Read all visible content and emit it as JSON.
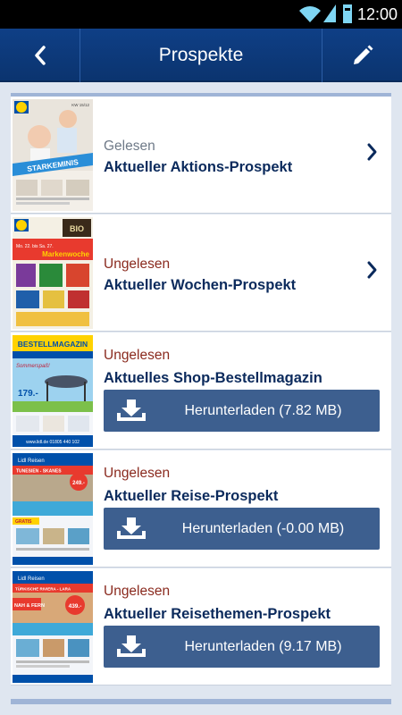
{
  "statusbar": {
    "time": "12:00"
  },
  "actionbar": {
    "title": "Prospekte"
  },
  "brochures": [
    {
      "status": "Gelesen",
      "title": "Aktueller Aktions-Prospekt",
      "action": "chevron",
      "thumb": {
        "header": "LIDL",
        "code": "KW 15/12",
        "banner": "STARKEMINIS"
      }
    },
    {
      "status": "Ungelesen",
      "title": "Aktueller Wochen-Prospekt",
      "action": "chevron",
      "thumb": {
        "header": "LIDL",
        "date": "Mo. 22. bis Sa. 27.",
        "banner": "Markenwoche",
        "badge": "BIO"
      }
    },
    {
      "status": "Ungelesen",
      "title": "Aktuelles Shop-Bestellmagazin",
      "action": "download",
      "download_label": "Herunterladen (7.82 MB)",
      "thumb": {
        "banner": "BESTELLMAGAZIN",
        "sub": "Sommerspaß!",
        "price": "179.-",
        "footer": "www.lidl.de  01805 440 102"
      }
    },
    {
      "status": "Ungelesen",
      "title": "Aktueller Reise-Prospekt",
      "action": "download",
      "download_label": "Herunterladen (-0.00 MB)",
      "thumb": {
        "header": "Lidl Reisen",
        "dest": "TUNESIEN - SKANES",
        "price": "249.-",
        "tag": "GRATIS"
      }
    },
    {
      "status": "Ungelesen",
      "title": "Aktueller Reisethemen-Prospekt",
      "action": "download",
      "download_label": "Herunterladen (9.17 MB)",
      "thumb": {
        "header": "Lidl Reisen",
        "dest": "TÜRKISCHE RIVIERA - LARA",
        "price": "439.-",
        "tag": "NAH & FERN"
      }
    }
  ]
}
